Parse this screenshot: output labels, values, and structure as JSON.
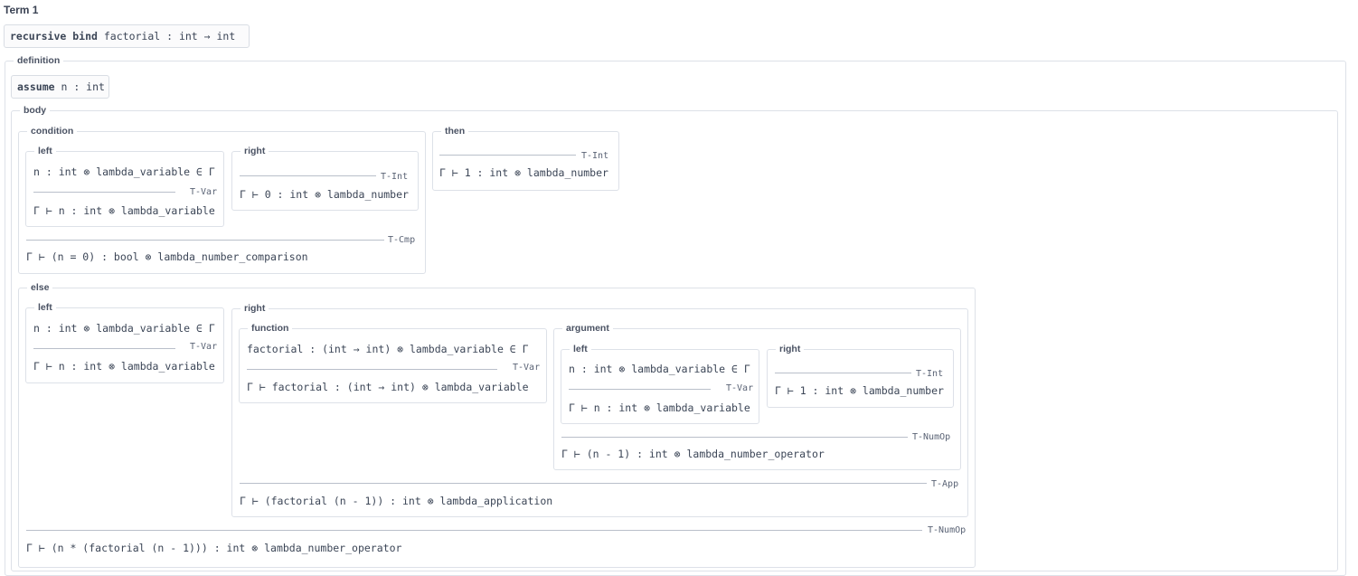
{
  "term_title": "Term 1",
  "header": {
    "kw": "recursive bind",
    "sig": "factorial : int → int"
  },
  "definition": {
    "legend": "definition",
    "assume": {
      "kw": "assume",
      "sig": "n : int"
    },
    "body": {
      "legend": "body",
      "condition": {
        "legend": "condition",
        "left": {
          "legend": "left",
          "premise": "n : int ⊗ lambda_variable ∈ Γ",
          "rule": "T-Var",
          "conclusion": "Γ ⊢ n : int ⊗ lambda_variable"
        },
        "right": {
          "legend": "right",
          "rule": "T-Int",
          "conclusion": "Γ ⊢ 0 : int ⊗ lambda_number"
        },
        "rule": "T-Cmp",
        "conclusion": "Γ ⊢ (n = 0) : bool ⊗ lambda_number_comparison"
      },
      "then": {
        "legend": "then",
        "rule": "T-Int",
        "conclusion": "Γ ⊢ 1 : int ⊗ lambda_number"
      },
      "else": {
        "legend": "else",
        "left": {
          "legend": "left",
          "premise": "n : int ⊗ lambda_variable ∈ Γ",
          "rule": "T-Var",
          "conclusion": "Γ ⊢ n : int ⊗ lambda_variable"
        },
        "right": {
          "legend": "right",
          "function": {
            "legend": "function",
            "premise": "factorial : (int → int) ⊗ lambda_variable ∈ Γ",
            "rule": "T-Var",
            "conclusion": "Γ ⊢ factorial : (int → int) ⊗ lambda_variable"
          },
          "argument": {
            "legend": "argument",
            "left": {
              "legend": "left",
              "premise": "n : int ⊗ lambda_variable ∈ Γ",
              "rule": "T-Var",
              "conclusion": "Γ ⊢ n : int ⊗ lambda_variable"
            },
            "right": {
              "legend": "right",
              "rule": "T-Int",
              "conclusion": "Γ ⊢ 1 : int ⊗ lambda_number"
            },
            "rule": "T-NumOp",
            "conclusion": "Γ ⊢ (n - 1) : int ⊗ lambda_number_operator"
          },
          "rule": "T-App",
          "conclusion": "Γ ⊢ (factorial (n - 1)) : int ⊗ lambda_application"
        },
        "rule": "T-NumOp",
        "conclusion": "Γ ⊢ (n * (factorial (n - 1))) : int ⊗ lambda_number_operator"
      }
    }
  }
}
